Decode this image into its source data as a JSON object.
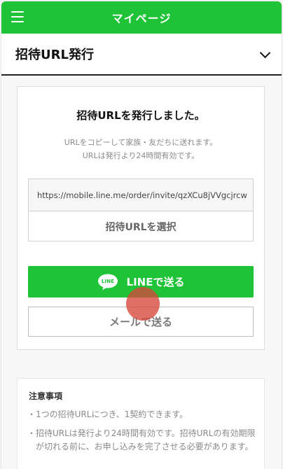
{
  "header": {
    "title": "マイページ",
    "menu_icon": "hamburger-menu-icon",
    "bg_color": "#1ec337"
  },
  "section": {
    "title": "招待URL発行",
    "toggle_icon": "chevron-down-icon"
  },
  "card": {
    "title": "招待URLを発行しました。",
    "desc_line1": "URLをコピーして家族・友だちに送れます。",
    "desc_line2": "URLは発行より24時間有効です。",
    "invite_url": "https://mobile.line.me/order/invite/qzXCu8jVVgcjrcw",
    "select_url_label": "招待URLを選択",
    "line_button_label": "LINEで送る",
    "line_logo_text": "LINE",
    "mail_button_label": "メールで送る"
  },
  "notice": {
    "title": "注意事項",
    "bullet": "・",
    "items": [
      "1つの招待URLにつき、1契約できます。",
      "招待URLは発行より24時間有効です。招待URLの有効期限が切れる前に、お申し込みを完了させる必要があります。"
    ]
  }
}
